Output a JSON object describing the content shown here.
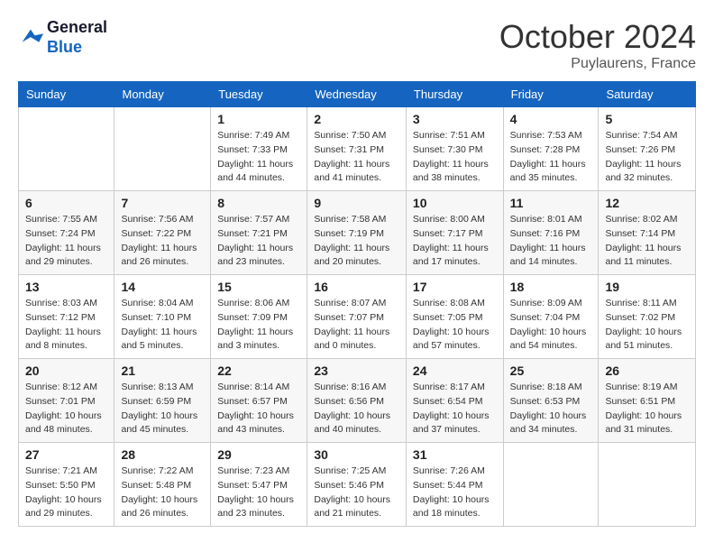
{
  "header": {
    "logo_line1": "General",
    "logo_line2": "Blue",
    "month_year": "October 2024",
    "location": "Puylaurens, France"
  },
  "days_of_week": [
    "Sunday",
    "Monday",
    "Tuesday",
    "Wednesday",
    "Thursday",
    "Friday",
    "Saturday"
  ],
  "weeks": [
    [
      null,
      null,
      {
        "num": "1",
        "sunrise": "Sunrise: 7:49 AM",
        "sunset": "Sunset: 7:33 PM",
        "daylight": "Daylight: 11 hours and 44 minutes."
      },
      {
        "num": "2",
        "sunrise": "Sunrise: 7:50 AM",
        "sunset": "Sunset: 7:31 PM",
        "daylight": "Daylight: 11 hours and 41 minutes."
      },
      {
        "num": "3",
        "sunrise": "Sunrise: 7:51 AM",
        "sunset": "Sunset: 7:30 PM",
        "daylight": "Daylight: 11 hours and 38 minutes."
      },
      {
        "num": "4",
        "sunrise": "Sunrise: 7:53 AM",
        "sunset": "Sunset: 7:28 PM",
        "daylight": "Daylight: 11 hours and 35 minutes."
      },
      {
        "num": "5",
        "sunrise": "Sunrise: 7:54 AM",
        "sunset": "Sunset: 7:26 PM",
        "daylight": "Daylight: 11 hours and 32 minutes."
      }
    ],
    [
      {
        "num": "6",
        "sunrise": "Sunrise: 7:55 AM",
        "sunset": "Sunset: 7:24 PM",
        "daylight": "Daylight: 11 hours and 29 minutes."
      },
      {
        "num": "7",
        "sunrise": "Sunrise: 7:56 AM",
        "sunset": "Sunset: 7:22 PM",
        "daylight": "Daylight: 11 hours and 26 minutes."
      },
      {
        "num": "8",
        "sunrise": "Sunrise: 7:57 AM",
        "sunset": "Sunset: 7:21 PM",
        "daylight": "Daylight: 11 hours and 23 minutes."
      },
      {
        "num": "9",
        "sunrise": "Sunrise: 7:58 AM",
        "sunset": "Sunset: 7:19 PM",
        "daylight": "Daylight: 11 hours and 20 minutes."
      },
      {
        "num": "10",
        "sunrise": "Sunrise: 8:00 AM",
        "sunset": "Sunset: 7:17 PM",
        "daylight": "Daylight: 11 hours and 17 minutes."
      },
      {
        "num": "11",
        "sunrise": "Sunrise: 8:01 AM",
        "sunset": "Sunset: 7:16 PM",
        "daylight": "Daylight: 11 hours and 14 minutes."
      },
      {
        "num": "12",
        "sunrise": "Sunrise: 8:02 AM",
        "sunset": "Sunset: 7:14 PM",
        "daylight": "Daylight: 11 hours and 11 minutes."
      }
    ],
    [
      {
        "num": "13",
        "sunrise": "Sunrise: 8:03 AM",
        "sunset": "Sunset: 7:12 PM",
        "daylight": "Daylight: 11 hours and 8 minutes."
      },
      {
        "num": "14",
        "sunrise": "Sunrise: 8:04 AM",
        "sunset": "Sunset: 7:10 PM",
        "daylight": "Daylight: 11 hours and 5 minutes."
      },
      {
        "num": "15",
        "sunrise": "Sunrise: 8:06 AM",
        "sunset": "Sunset: 7:09 PM",
        "daylight": "Daylight: 11 hours and 3 minutes."
      },
      {
        "num": "16",
        "sunrise": "Sunrise: 8:07 AM",
        "sunset": "Sunset: 7:07 PM",
        "daylight": "Daylight: 11 hours and 0 minutes."
      },
      {
        "num": "17",
        "sunrise": "Sunrise: 8:08 AM",
        "sunset": "Sunset: 7:05 PM",
        "daylight": "Daylight: 10 hours and 57 minutes."
      },
      {
        "num": "18",
        "sunrise": "Sunrise: 8:09 AM",
        "sunset": "Sunset: 7:04 PM",
        "daylight": "Daylight: 10 hours and 54 minutes."
      },
      {
        "num": "19",
        "sunrise": "Sunrise: 8:11 AM",
        "sunset": "Sunset: 7:02 PM",
        "daylight": "Daylight: 10 hours and 51 minutes."
      }
    ],
    [
      {
        "num": "20",
        "sunrise": "Sunrise: 8:12 AM",
        "sunset": "Sunset: 7:01 PM",
        "daylight": "Daylight: 10 hours and 48 minutes."
      },
      {
        "num": "21",
        "sunrise": "Sunrise: 8:13 AM",
        "sunset": "Sunset: 6:59 PM",
        "daylight": "Daylight: 10 hours and 45 minutes."
      },
      {
        "num": "22",
        "sunrise": "Sunrise: 8:14 AM",
        "sunset": "Sunset: 6:57 PM",
        "daylight": "Daylight: 10 hours and 43 minutes."
      },
      {
        "num": "23",
        "sunrise": "Sunrise: 8:16 AM",
        "sunset": "Sunset: 6:56 PM",
        "daylight": "Daylight: 10 hours and 40 minutes."
      },
      {
        "num": "24",
        "sunrise": "Sunrise: 8:17 AM",
        "sunset": "Sunset: 6:54 PM",
        "daylight": "Daylight: 10 hours and 37 minutes."
      },
      {
        "num": "25",
        "sunrise": "Sunrise: 8:18 AM",
        "sunset": "Sunset: 6:53 PM",
        "daylight": "Daylight: 10 hours and 34 minutes."
      },
      {
        "num": "26",
        "sunrise": "Sunrise: 8:19 AM",
        "sunset": "Sunset: 6:51 PM",
        "daylight": "Daylight: 10 hours and 31 minutes."
      }
    ],
    [
      {
        "num": "27",
        "sunrise": "Sunrise: 7:21 AM",
        "sunset": "Sunset: 5:50 PM",
        "daylight": "Daylight: 10 hours and 29 minutes."
      },
      {
        "num": "28",
        "sunrise": "Sunrise: 7:22 AM",
        "sunset": "Sunset: 5:48 PM",
        "daylight": "Daylight: 10 hours and 26 minutes."
      },
      {
        "num": "29",
        "sunrise": "Sunrise: 7:23 AM",
        "sunset": "Sunset: 5:47 PM",
        "daylight": "Daylight: 10 hours and 23 minutes."
      },
      {
        "num": "30",
        "sunrise": "Sunrise: 7:25 AM",
        "sunset": "Sunset: 5:46 PM",
        "daylight": "Daylight: 10 hours and 21 minutes."
      },
      {
        "num": "31",
        "sunrise": "Sunrise: 7:26 AM",
        "sunset": "Sunset: 5:44 PM",
        "daylight": "Daylight: 10 hours and 18 minutes."
      },
      null,
      null
    ]
  ]
}
